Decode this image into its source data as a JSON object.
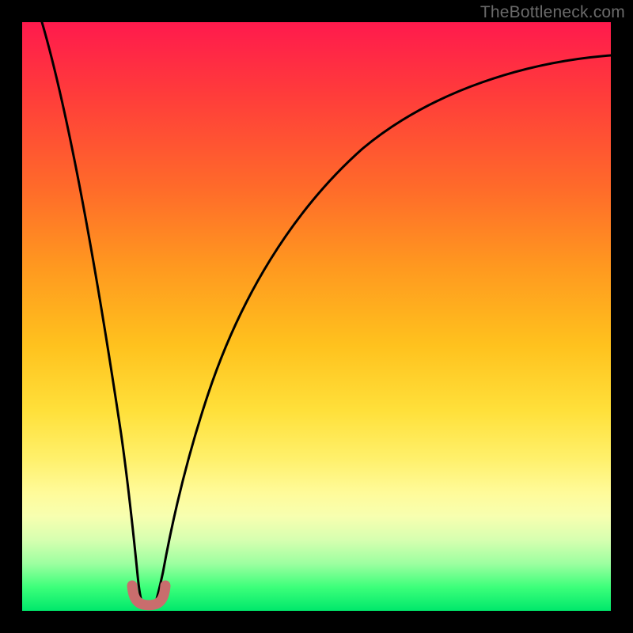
{
  "watermark": "TheBottleneck.com",
  "chart_data": {
    "type": "line",
    "title": "",
    "xlabel": "",
    "ylabel": "",
    "xlim": [
      0,
      100
    ],
    "ylim": [
      0,
      100
    ],
    "grid": false,
    "legend": false,
    "series": [
      {
        "name": "bottleneck-curve",
        "x": [
          0,
          4,
          8,
          12,
          15,
          17,
          18.5,
          19.5,
          20.5,
          21.5,
          23,
          25,
          28,
          32,
          38,
          45,
          55,
          65,
          75,
          85,
          95,
          100
        ],
        "y": [
          100,
          82,
          64,
          46,
          30,
          17,
          7,
          2,
          2,
          7,
          18,
          30,
          43,
          55,
          67,
          76,
          83,
          87.5,
          90.5,
          92.5,
          94,
          94.5
        ]
      },
      {
        "name": "minimum-marker",
        "x": [
          18.2,
          19.0,
          20.0,
          21.0,
          21.8
        ],
        "y": [
          4.0,
          1.8,
          1.5,
          1.8,
          4.0
        ]
      }
    ],
    "annotations": [],
    "colors": {
      "curve": "#000000",
      "marker": "#c96d6d",
      "gradient_top": "#ff1a4d",
      "gradient_bottom": "#00e86b"
    }
  }
}
